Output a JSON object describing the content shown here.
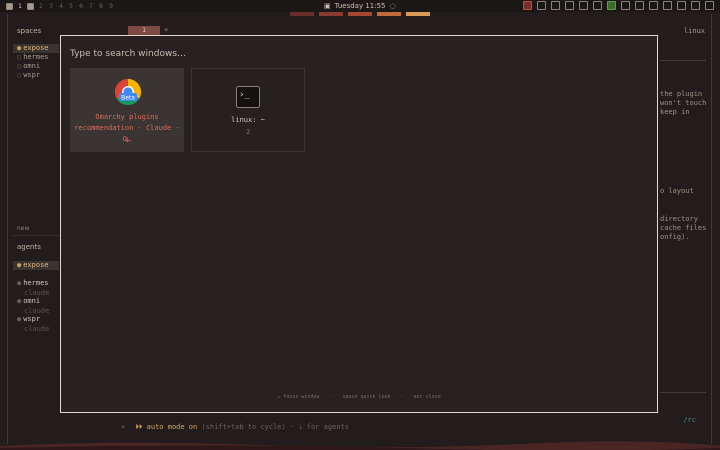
{
  "topbar": {
    "workspaces": [
      "1",
      "2",
      "3",
      "4",
      "5",
      "6",
      "7",
      "8",
      "9"
    ],
    "clock": "Tuesday 11:55"
  },
  "colors": {
    "accent": "#e06a5a",
    "highlight": "#e0b37a",
    "stripes": [
      "#6b2d2a",
      "#8a3a33",
      "#a6482f",
      "#c26a3a",
      "#d99a56"
    ]
  },
  "sidebar": {
    "spaces_heading": "spaces",
    "spaces": [
      "expose",
      "hermes",
      "omni",
      "wspr"
    ],
    "new_label": "new",
    "agents_heading": "agents",
    "agents": [
      {
        "name": "expose",
        "sub": ""
      },
      {
        "name": "hermes",
        "sub": "claude"
      },
      {
        "name": "omni",
        "sub": "claude"
      },
      {
        "name": "wspr",
        "sub": "claude"
      }
    ]
  },
  "tabbar": {
    "tab1": "1",
    "plus": "+",
    "right_label": "linux"
  },
  "background_text": {
    "lines_a": [
      "the plugin",
      "won't touch",
      "keep in"
    ],
    "line_b": "o layout",
    "lines_c": [
      "directory",
      "cache files",
      "onfig)."
    ],
    "rc": "/rc"
  },
  "prompt": {
    "icon": "»",
    "auto_mode": "⏵⏵ auto mode on",
    "rest": "(shift+tab to cycle) · ↓ for agents"
  },
  "overlay": {
    "search_placeholder": "Type to search windows…",
    "windows": [
      {
        "app": "chrome-beta-icon",
        "badge": "Beta",
        "title1": "Omarchy plugins",
        "title2": "recommendation - Claude - G…",
        "number": "1"
      },
      {
        "app": "terminal-icon",
        "title1": "linux: ~",
        "number": "2"
      }
    ],
    "hints": [
      "↵ focus window",
      "space quick look",
      "esc close"
    ]
  }
}
